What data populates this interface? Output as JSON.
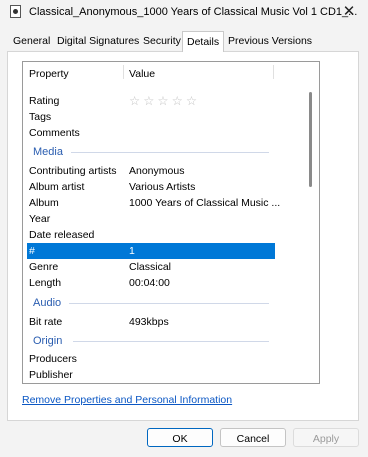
{
  "window": {
    "title": "Classical_Anonymous_1000 Years of Classical Music Vol 1 CD1_...",
    "close_symbol": "✕"
  },
  "tabs": [
    {
      "label": "General"
    },
    {
      "label": "Digital Signatures"
    },
    {
      "label": "Security"
    },
    {
      "label": "Details",
      "active": true
    },
    {
      "label": "Previous Versions"
    }
  ],
  "list": {
    "header": {
      "property": "Property",
      "value": "Value"
    },
    "rows": {
      "rating": {
        "label": "Rating",
        "stars": "☆☆☆☆☆"
      },
      "tags": {
        "label": "Tags",
        "value": ""
      },
      "comments": {
        "label": "Comments",
        "value": ""
      },
      "contributing_artists": {
        "label": "Contributing artists",
        "value": "Anonymous"
      },
      "album_artist": {
        "label": "Album artist",
        "value": "Various Artists"
      },
      "album": {
        "label": "Album",
        "value": "1000 Years of Classical Music ..."
      },
      "year": {
        "label": "Year",
        "value": ""
      },
      "date_released": {
        "label": "Date released",
        "value": ""
      },
      "track_number": {
        "label": "#",
        "value": "1"
      },
      "genre": {
        "label": "Genre",
        "value": "Classical"
      },
      "length": {
        "label": "Length",
        "value": "00:04:00"
      },
      "bit_rate": {
        "label": "Bit rate",
        "value": "493kbps"
      },
      "producers": {
        "label": "Producers",
        "value": ""
      },
      "publisher": {
        "label": "Publisher",
        "value": ""
      }
    },
    "sections": {
      "media": "Media",
      "audio": "Audio",
      "origin": "Origin"
    }
  },
  "remove_link": "Remove Properties and Personal Information",
  "buttons": {
    "ok": "OK",
    "cancel": "Cancel",
    "apply": "Apply"
  },
  "colors": {
    "selection": "#0078d7",
    "section_text": "#2a5db0",
    "link": "#0b57c4"
  }
}
